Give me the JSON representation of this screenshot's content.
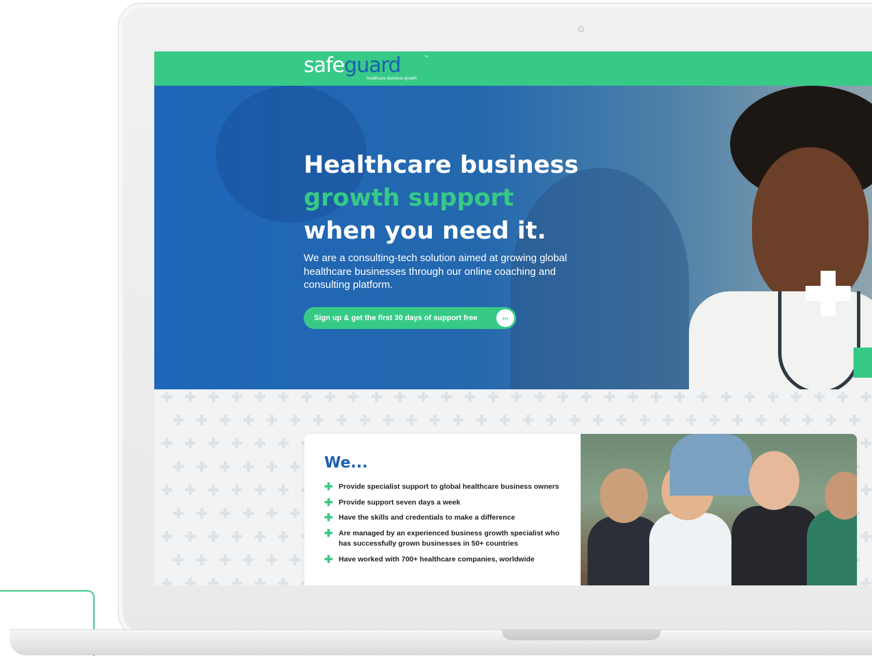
{
  "logo": {
    "safe": "saf",
    "plus_e": "e",
    "guard": "guard",
    "tm": "™",
    "tagline": "healthcare business growth"
  },
  "hero": {
    "title_line1": "Healthcare business",
    "title_line2": "growth support",
    "title_line3": "when you need it.",
    "description": "We are a consulting-tech solution aimed at growing global healthcare businesses through our online coaching and consulting platform.",
    "cta_label": "Sign up & get the first 30 days of support free",
    "cta_arrow": "›››"
  },
  "we": {
    "title": "We...",
    "items": [
      "Provide specialist support to global healthcare business owners",
      "Provide support seven days a week",
      "Have the skills and credentials to make a difference",
      "Are managed by an experienced business growth specialist who has successfully grown businesses in 50+ countries",
      "Have worked with 700+ healthcare companies, worldwide"
    ]
  },
  "colors": {
    "brand_green": "#37ca87",
    "brand_blue": "#1a5fb0"
  }
}
